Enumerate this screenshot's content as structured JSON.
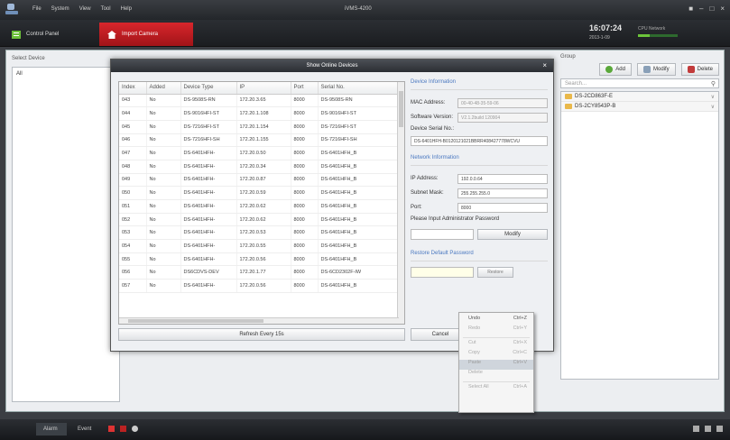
{
  "titlebar": {
    "menus": [
      "File",
      "System",
      "View",
      "Tool",
      "Help"
    ],
    "title": "iVMS-4200"
  },
  "tabs": {
    "control_panel": "Control Panel",
    "import_camera": "Import Camera"
  },
  "header": {
    "time": "16:07:24",
    "date": "2013-1-09",
    "cpu_label": "CPU",
    "network_label": "Network"
  },
  "left_panel": {
    "title": "Select Device",
    "all_label": "All"
  },
  "right_panel": {
    "title": "Group",
    "add": "Add",
    "modify": "Modify",
    "delete": "Delete",
    "search_placeholder": "Search...",
    "groups": [
      "DS-2CD863F-E",
      "DS-2CY8543P-B"
    ]
  },
  "dialog": {
    "title": "Show Online Devices",
    "columns": [
      "Index",
      "Added",
      "Device Type",
      "IP",
      "Port",
      "Serial No."
    ],
    "rows": [
      [
        "043",
        "No",
        "DS-9508S-RN",
        "172.20.3.65",
        "8000",
        "DS-9508S-RN"
      ],
      [
        "044",
        "No",
        "DS-9016HFI-ST",
        "172.20.1.108",
        "8000",
        "DS-9016HFI-ST"
      ],
      [
        "045",
        "No",
        "DS-7216HFI-ST",
        "172.20.1.154",
        "8000",
        "DS-7216HFI-ST"
      ],
      [
        "046",
        "No",
        "DS-7216HFI-SH",
        "172.20.1.155",
        "8000",
        "DS-7216HFI-SH"
      ],
      [
        "047",
        "No",
        "DS-6401HFH-",
        "172.20.0.50",
        "8000",
        "DS-6401HFH_B"
      ],
      [
        "048",
        "No",
        "DS-6401HFH-",
        "172.20.0.34",
        "8000",
        "DS-6401HFH_B"
      ],
      [
        "049",
        "No",
        "DS-6401HFH-",
        "172.20.0.87",
        "8000",
        "DS-6401HFH_B"
      ],
      [
        "050",
        "No",
        "DS-6401HFH-",
        "172.20.0.59",
        "8000",
        "DS-6401HFH_B"
      ],
      [
        "051",
        "No",
        "DS-6401HFH-",
        "172.20.0.62",
        "8000",
        "DS-6401HFH_B"
      ],
      [
        "052",
        "No",
        "DS-6401HFH-",
        "172.20.0.62",
        "8000",
        "DS-6401HFH_B"
      ],
      [
        "053",
        "No",
        "DS-6401HFH-",
        "172.20.0.53",
        "8000",
        "DS-6401HFH_B"
      ],
      [
        "054",
        "No",
        "DS-6401HFH-",
        "172.20.0.55",
        "8000",
        "DS-6401HFH_B"
      ],
      [
        "055",
        "No",
        "DS-6401HFH-",
        "172.20.0.56",
        "8000",
        "DS-6401HFH_B"
      ],
      [
        "056",
        "No",
        "DS6CDVS-DEV",
        "172.20.1.77",
        "8000",
        "DS-6CD2302F-IW"
      ],
      [
        "057",
        "No",
        "DS-6401HFH-",
        "172.20.0.56",
        "8000",
        "DS-6401HFH_B"
      ]
    ],
    "refresh": "Refresh Every 15s",
    "device_info_title": "Device Information",
    "mac_label": "MAC Address:",
    "mac_value": "00-40-48-35-59-06",
    "sw_label": "Software Version:",
    "sw_value": "V2.1.2build 120904",
    "serial_label": "Device Serial No.:",
    "serial_value": "DS-6401HFH-B0120121021BBRR408427778WCVU",
    "network_title": "Network Information",
    "ip_label": "IP Address:",
    "ip_value": "192.0.0.64",
    "mask_label": "Subnet Mask:",
    "mask_value": "255.255.255.0",
    "port_label": "Port:",
    "port_value": "8000",
    "admin_pw_label": "Please Input Administrator Password",
    "modify_btn": "Modify",
    "restore_title": "Restore Default Password",
    "restore_btn": "Restore",
    "save_btn": "Cancel"
  },
  "context_menu": [
    {
      "label": "Undo",
      "key": "Ctrl+Z",
      "state": "normal"
    },
    {
      "label": "Redo",
      "key": "Ctrl+Y",
      "state": "disabled"
    },
    {
      "label": "Cut",
      "key": "Ctrl+X",
      "state": "disabled"
    },
    {
      "label": "Copy",
      "key": "Ctrl+C",
      "state": "disabled"
    },
    {
      "label": "Paste",
      "key": "Ctrl+V",
      "state": "highlight"
    },
    {
      "label": "Delete",
      "key": "",
      "state": "disabled"
    },
    {
      "label": "Select All",
      "key": "Ctrl+A",
      "state": "disabled"
    }
  ],
  "statusbar": {
    "alarm": "Alarm",
    "event": "Event"
  }
}
